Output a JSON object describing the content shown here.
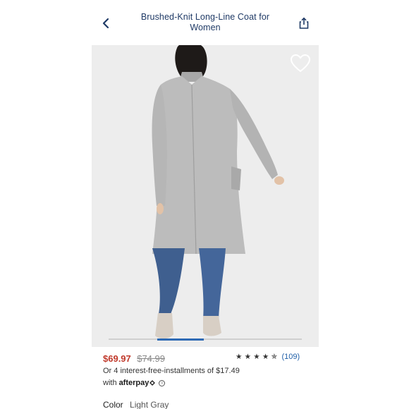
{
  "header": {
    "title": "Brushed-Knit Long-Line Coat for Women"
  },
  "product": {
    "sale_price": "$69.97",
    "original_price": "$74.99",
    "rating_count": "(109)",
    "installments_text": "Or 4 interest-free-installments of $17.49",
    "afterpay_prefix": "with",
    "afterpay_brand": "afterpay",
    "color_label": "Color",
    "color_value": "Light Gray"
  },
  "rating": {
    "stars": 4.5,
    "max": 5
  },
  "carousel": {
    "position_fraction": 0.25
  },
  "colors": {
    "title": "#1f3a66",
    "sale_price": "#c0392b",
    "link": "#1f5fa8",
    "carousel_active": "#2f6bb5",
    "coat": "#bdbdbd"
  }
}
